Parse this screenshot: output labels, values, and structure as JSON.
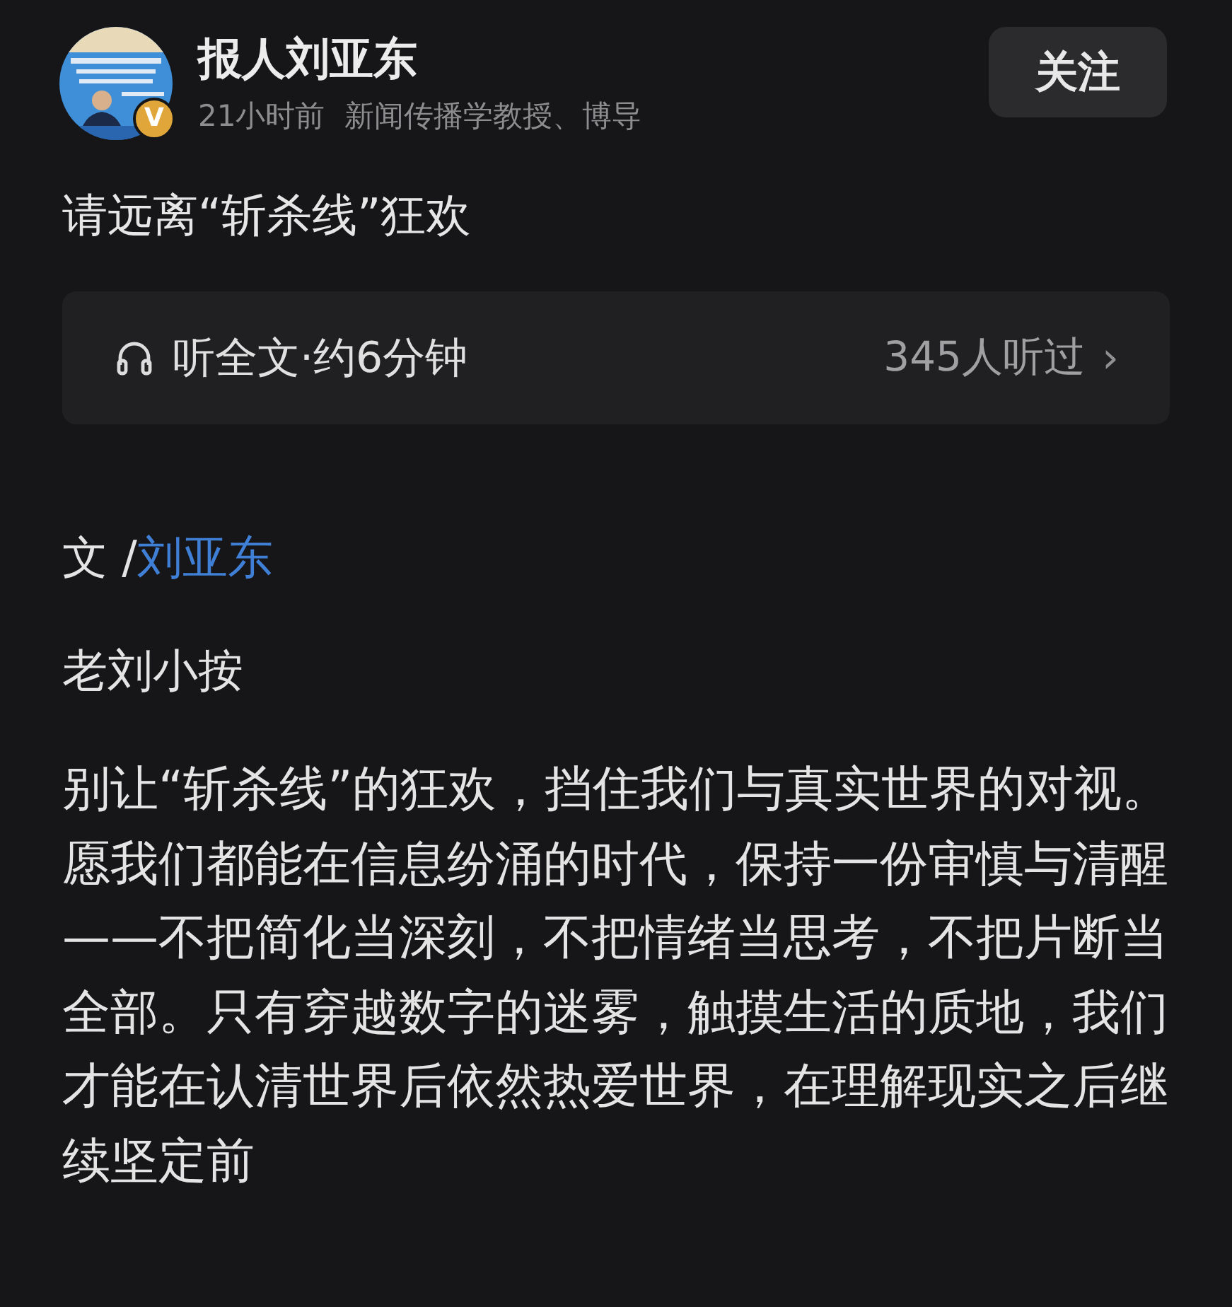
{
  "author": {
    "name": "报人刘亚东",
    "verified_badge": "V",
    "time": "21小时前",
    "bio": "新闻传播学教授、博导",
    "follow_button": "关注"
  },
  "article": {
    "title": "请远离“斩杀线”狂欢",
    "listen": {
      "label": "听全文·约6分钟",
      "count": "345人听过",
      "chevron": "›"
    },
    "byline": {
      "prefix": "文 /",
      "author_link": "刘亚东"
    },
    "section_heading": "老刘小按",
    "paragraph": "别让“斩杀线”的狂欢，挡住我们与真实世界的对视。愿我们都能在信息纷涌的时代，保持一份审慎与清醒——不把简化当深刻，不把情绪当思考，不把片断当全部。只有穿越数字的迷雾，触摸生活的质地，我们才能在认清世界后依然热爱世界，在理解现实之后继续坚定前"
  }
}
